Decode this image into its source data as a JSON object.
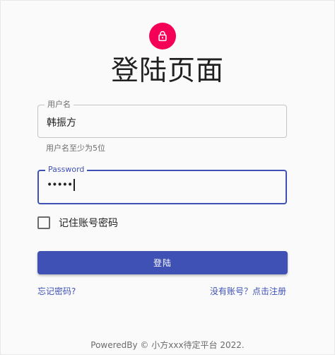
{
  "page": {
    "title": "登陆页面",
    "accent_color": "#3f51b5",
    "avatar_color": "#f50057",
    "avatar_icon": "lock-icon"
  },
  "username": {
    "label": "用户名",
    "value": "韩振方",
    "helper": "用户名至少为5位"
  },
  "password": {
    "label": "Password",
    "value": "•••••"
  },
  "remember": {
    "label": "记住账号密码",
    "checked": false
  },
  "actions": {
    "submit_label": "登陆",
    "forgot_label": "忘记密码?",
    "register_label": "没有账号？点击注册"
  },
  "footer": {
    "text": "PoweredBy © 小方xxx待定平台 2022."
  }
}
